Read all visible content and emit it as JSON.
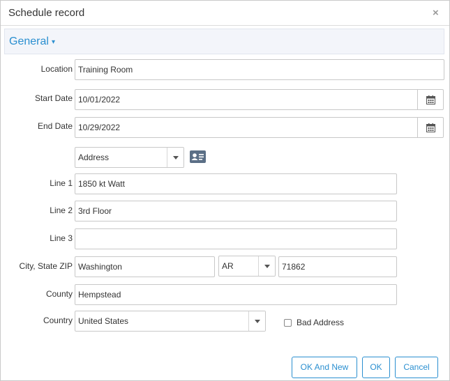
{
  "dialog": {
    "title": "Schedule record",
    "close_glyph": "×"
  },
  "section": {
    "label": "General",
    "caret": "▾"
  },
  "fields": {
    "location": {
      "label": "Location",
      "value": "Training Room"
    },
    "start_date": {
      "label": "Start Date",
      "value": "10/01/2022"
    },
    "end_date": {
      "label": "End Date",
      "value": "10/29/2022"
    },
    "address_type": {
      "value": "Address"
    },
    "line1": {
      "label": "Line 1",
      "value": "1850 kt Watt"
    },
    "line2": {
      "label": "Line 2",
      "value": "3rd Floor"
    },
    "line3": {
      "label": "Line 3",
      "value": ""
    },
    "city_state_zip": {
      "label": "City, State ZIP",
      "city": "Washington",
      "state": "AR",
      "zip": "71862"
    },
    "county": {
      "label": "County",
      "value": "Hempstead"
    },
    "country": {
      "label": "Country",
      "value": "United States"
    },
    "bad_address": {
      "label": "Bad Address",
      "checked": false
    }
  },
  "buttons": {
    "ok_and_new": "OK And New",
    "ok": "OK",
    "cancel": "Cancel"
  },
  "icons": {
    "calendar": "calendar-icon",
    "address_card": "address-card-icon",
    "close": "close-icon"
  },
  "colors": {
    "accent": "#2a8fd0",
    "section_bg": "#f3f5fa",
    "icon_gray": "#5b6f86"
  }
}
